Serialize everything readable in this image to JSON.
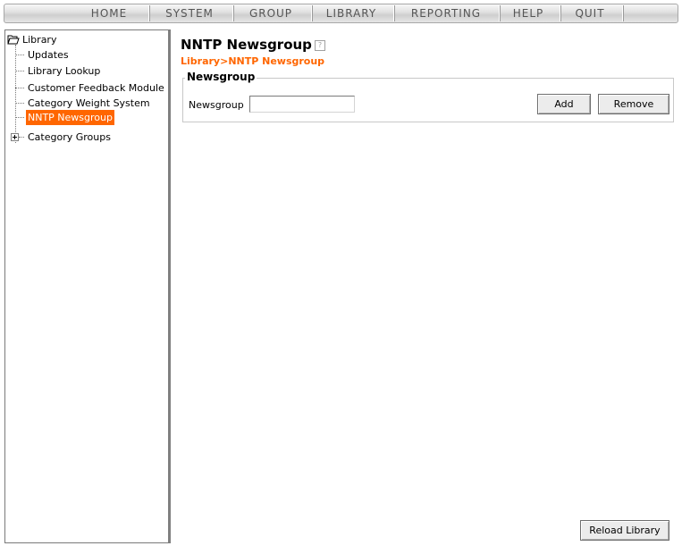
{
  "menu": {
    "items": [
      "HOME",
      "SYSTEM",
      "GROUP",
      "LIBRARY",
      "REPORTING",
      "HELP",
      "QUIT"
    ]
  },
  "tree": {
    "root_label": "Library",
    "children": [
      "Updates",
      "Library Lookup",
      "Customer Feedback Module",
      "Category Weight System",
      "NNTP Newsgroup"
    ],
    "selected": "NNTP Newsgroup",
    "collapsed_node": "Category Groups"
  },
  "page": {
    "title": "NNTP Newsgroup",
    "help_glyph": "?",
    "breadcrumb": "Library>NNTP Newsgroup"
  },
  "form": {
    "legend": "Newsgroup",
    "field_label": "Newsgroup",
    "field_value": "",
    "add_label": "Add",
    "remove_label": "Remove"
  },
  "footer": {
    "reload_label": "Reload Library"
  },
  "colors": {
    "accent": "#ff6600",
    "selected_text": "#ffffff"
  }
}
